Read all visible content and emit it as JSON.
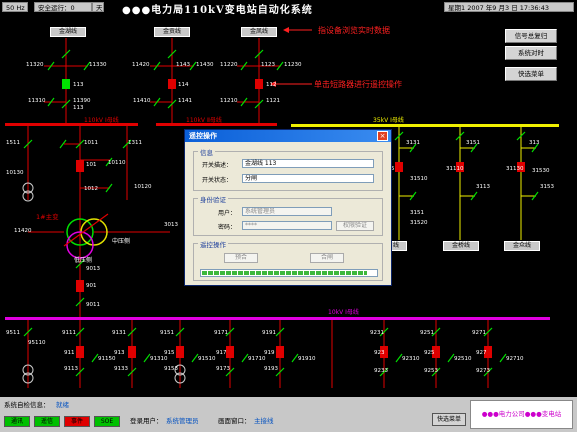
{
  "topbar": {
    "hz": "50 Hz",
    "safe_run": "安全运行：0",
    "days": "天",
    "title": "●●●电力局110kV变电站自动化系统",
    "datetime": "星期1  2007 年9 月3 日  17:36:43"
  },
  "annotations": {
    "browse": "指设备浏览实时数据",
    "control": "单击短路器进行遥控操作"
  },
  "feeders_top": [
    "金湖线",
    "金贡线",
    "金凤线"
  ],
  "feeders_mid": [
    "线",
    "金桥线",
    "金众线"
  ],
  "right_buttons": [
    "信号总复归",
    "系统对时",
    "快选菜单"
  ],
  "bus": {
    "b1": "110kV Ⅰ母线",
    "b2": "110kV Ⅱ母线",
    "b3": "35kV Ⅰ母线",
    "b4": "10kV Ⅰ母线"
  },
  "labels": {
    "main_transformer": "1#主变",
    "mid_side": "中压侧",
    "low_side": "低压侧"
  },
  "equip_ids": {
    "top_left": [
      "11320",
      "113",
      "11330",
      "11310",
      "11390",
      "113"
    ],
    "top_mid": [
      "11420",
      "1143",
      "11430",
      "114",
      "11410",
      "1141"
    ],
    "top_right": [
      "11220",
      "1123",
      "11230",
      "112",
      "11210",
      "1121"
    ],
    "left_col": [
      "1511",
      "1011",
      "10110",
      "1311",
      "10130",
      "101",
      "1012",
      "10120",
      "11420",
      "3013",
      "9013",
      "901",
      "9011"
    ],
    "right_top": [
      "3131",
      "3151",
      "313",
      "315",
      "31110",
      "31130",
      "31510",
      "31520",
      "31530",
      "3113",
      "3153",
      "3151"
    ],
    "bottom": [
      "9511",
      "95110",
      "9111",
      "911",
      "9113",
      "9131",
      "913",
      "9133",
      "9151",
      "915",
      "9153",
      "9171",
      "917",
      "9173",
      "9191",
      "919",
      "9193",
      "9231",
      "923",
      "9233",
      "9251",
      "925",
      "9253",
      "9271",
      "927",
      "9273",
      "91150",
      "91310",
      "91510",
      "91710",
      "91910",
      "92310",
      "92510",
      "92710"
    ]
  },
  "dialog": {
    "title": "遥控操作",
    "info_group": "信息",
    "switch_desc_label": "开关描述：",
    "switch_desc_value": "金湖线 113",
    "switch_state_label": "开关状态：",
    "switch_state_value": "分闸",
    "auth_group": "身份验证",
    "user_label": "用户：",
    "user_value": "系统管理员",
    "password_label": "密码：",
    "password_value": "****",
    "verify_button": "权限验证",
    "control_group": "遥控操作",
    "pre_close_button": "预合",
    "close_button": "合闸",
    "progress": 0.95
  },
  "statusbar": {
    "check_label": "系统自检信息：",
    "check_value": "就绪",
    "login_label": "登录用户：",
    "login_value": "系统管理员",
    "window_label": "画面窗口：",
    "window_value": "主接线",
    "quick_menu": "快选菜单",
    "company": "●●●电力公司●●●变电站",
    "indicators": [
      {
        "label": "通讯",
        "color": "#00c000"
      },
      {
        "label": "遥信",
        "color": "#00c000"
      },
      {
        "label": "事件",
        "color": "#e00000"
      },
      {
        "label": "SOE",
        "color": "#00c000"
      }
    ]
  },
  "colors": {
    "bus_110": "#e00000",
    "bus_35": "#f0f000",
    "bus_10": "#e000e0",
    "breaker_closed": "#e00000",
    "breaker_open": "#00e000",
    "line": "#e00000"
  }
}
